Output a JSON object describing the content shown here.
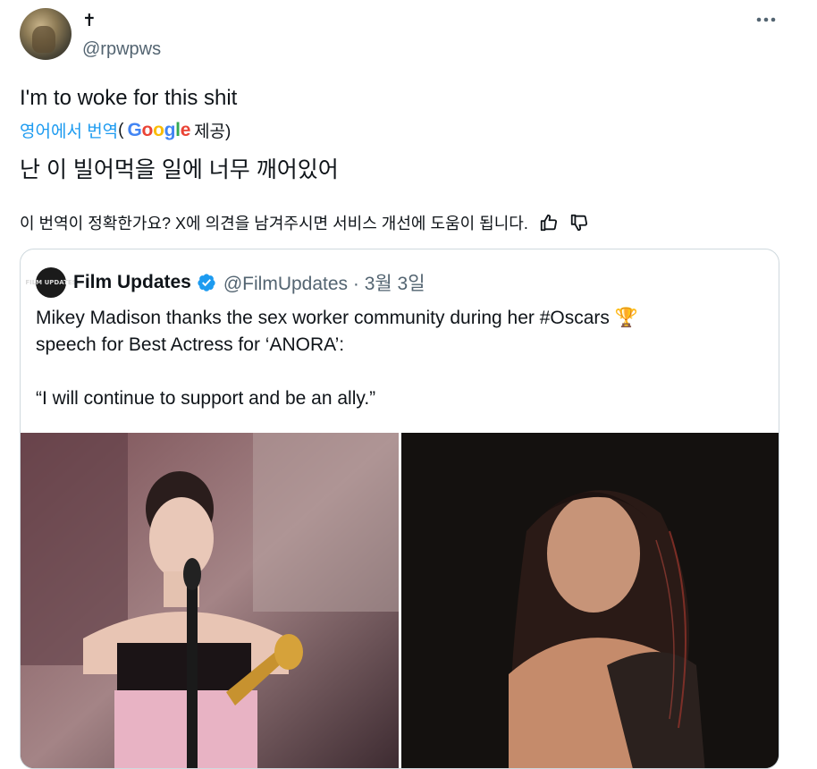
{
  "author": {
    "display_name": "✝",
    "handle": "@rpwpws"
  },
  "tweet": {
    "text": "I'm to woke for this shit",
    "translated_from": "영어에서 번역",
    "translated_open": "(",
    "translator": "Google",
    "translated_provided": "제공)",
    "translation": "난 이 빌어먹을 일에 너무 깨어있어",
    "feedback_prompt": "이 번역이 정확한가요? X에 의견을 남겨주시면 서비스 개선에 도움이 됩니다."
  },
  "quoted": {
    "avatar_text": "FILM UPDATES",
    "name": "Film Updates",
    "handle_date": "@FilmUpdates · 3월 3일",
    "line1": "Mikey Madison thanks the sex worker community during her #Oscars 🏆",
    "line2": "speech for Best Actress for ‘ANORA’:",
    "line3": "“I will continue to support and be an ally.”"
  },
  "colors": {
    "link": "#1d9bf0",
    "secondary_text": "#536471",
    "border": "#cfd9de",
    "verified": "#1d9bf0"
  },
  "icons": [
    "more-icon",
    "thumbs-up-icon",
    "thumbs-down-icon",
    "verified-badge-icon",
    "google-logo"
  ]
}
